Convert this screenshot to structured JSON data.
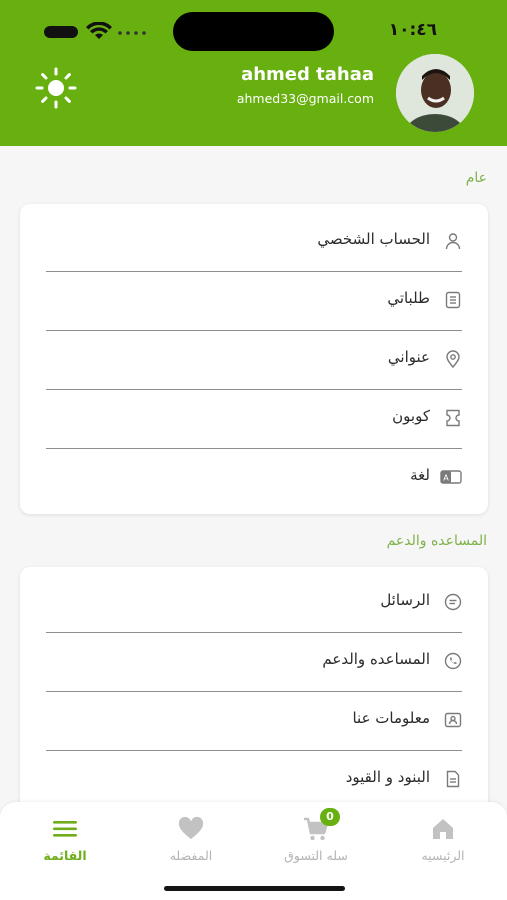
{
  "status_bar": {
    "time": "١٠:٤٦"
  },
  "profile": {
    "name": "ahmed tahaa",
    "email": "ahmed33@gmail.com"
  },
  "sections": {
    "general": {
      "label": "عام",
      "items": [
        {
          "label": "الحساب الشخصي",
          "icon": "user-icon"
        },
        {
          "label": "طلباتي",
          "icon": "orders-icon"
        },
        {
          "label": "عنواني",
          "icon": "location-pin-icon"
        },
        {
          "label": "كوبون",
          "icon": "coupon-icon"
        },
        {
          "label": "لغة",
          "icon": "language-icon"
        }
      ]
    },
    "support": {
      "label": "المساعده والدعم",
      "items": [
        {
          "label": "الرسائل",
          "icon": "message-icon"
        },
        {
          "label": "المساعده والدعم",
          "icon": "phone-icon"
        },
        {
          "label": "معلومات عنا",
          "icon": "about-icon"
        },
        {
          "label": "البنود و القيود",
          "icon": "document-icon"
        }
      ]
    }
  },
  "bottom_nav": {
    "items": [
      {
        "label": "الرئيسيه",
        "icon": "home-icon",
        "active": false
      },
      {
        "label": "سله التسوق",
        "icon": "cart-icon",
        "active": false,
        "badge": "0"
      },
      {
        "label": "المفضله",
        "icon": "heart-icon",
        "active": false
      },
      {
        "label": "القائمة",
        "icon": "menu-icon",
        "active": true
      }
    ]
  },
  "colors": {
    "primary": "#68b010",
    "section_label": "#7fb24a",
    "inactive": "#b3b3b3",
    "background": "#f6f6f6"
  }
}
